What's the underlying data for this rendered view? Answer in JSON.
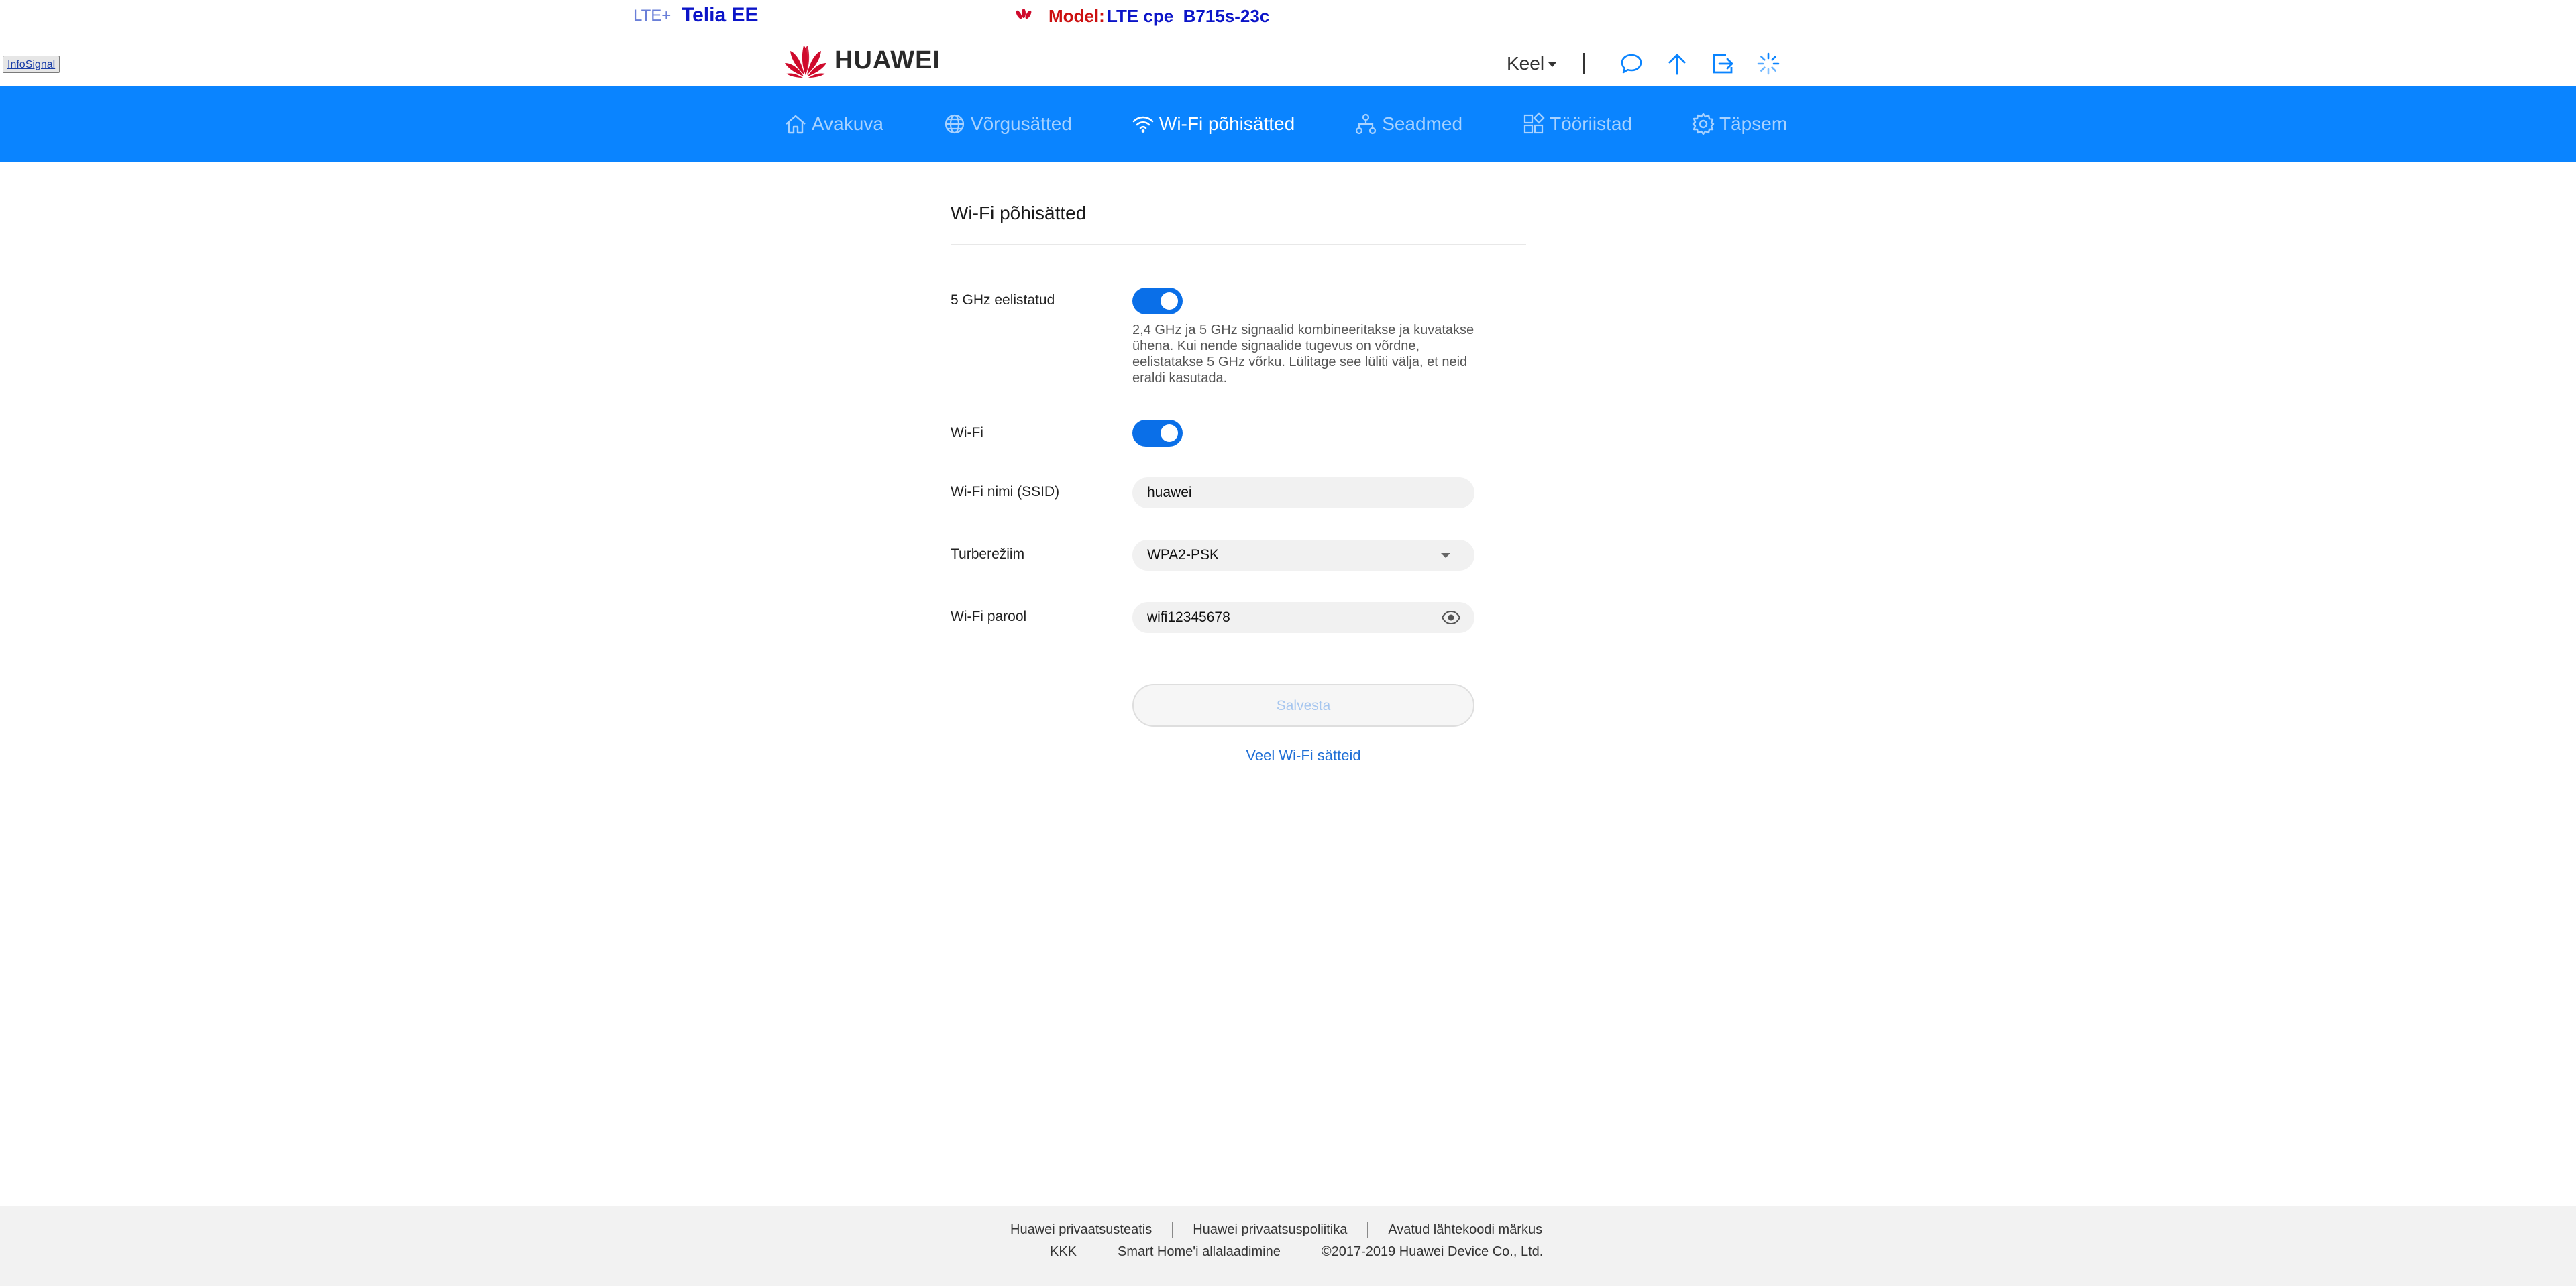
{
  "status": {
    "network_type": "LTE+",
    "operator": "Telia EE",
    "model_label": "Model:",
    "model_value": "LTE cpe  B715s-23c"
  },
  "info_button": "InfoSignal",
  "header": {
    "brand": "HUAWEI",
    "language": "Keel",
    "icons": [
      "message-icon",
      "upload-icon",
      "logout-icon",
      "loading-icon"
    ]
  },
  "nav": {
    "items": [
      {
        "label": "Avakuva",
        "icon": "home-icon",
        "active": false
      },
      {
        "label": "Võrgusätted",
        "icon": "globe-icon",
        "active": false
      },
      {
        "label": "Wi-Fi põhisätted",
        "icon": "wifi-icon",
        "active": true
      },
      {
        "label": "Seadmed",
        "icon": "network-devices-icon",
        "active": false
      },
      {
        "label": "Tööriistad",
        "icon": "tools-grid-icon",
        "active": false
      },
      {
        "label": "Täpsem",
        "icon": "gear-icon",
        "active": false
      }
    ]
  },
  "main": {
    "title": "Wi-Fi põhisätted",
    "band_pref": {
      "label": "5 GHz eelistatud",
      "enabled": true,
      "hint": "2,4 GHz ja 5 GHz signaalid kombineeritakse ja kuvatakse ühena. Kui nende signaalide tugevus on võrdne, eelistatakse 5 GHz võrku. Lülitage see lüliti välja, et neid eraldi kasutada."
    },
    "wifi": {
      "label": "Wi-Fi",
      "enabled": true
    },
    "ssid": {
      "label": "Wi-Fi nimi (SSID)",
      "value": "huawei"
    },
    "security": {
      "label": "Turberežiim",
      "value": "WPA2-PSK"
    },
    "password": {
      "label": "Wi-Fi parool",
      "value": "wifi12345678"
    },
    "save_label": "Salvesta",
    "more_link": "Veel Wi-Fi sätteid"
  },
  "footer": {
    "row1": [
      "Huawei privaatsusteatis",
      "Huawei privaatsuspoliitika",
      "Avatud lähtekoodi märkus"
    ],
    "row2": [
      "KKK",
      "Smart Home'i allalaadimine",
      "©2017-2019 Huawei Device Co., Ltd."
    ]
  },
  "colors": {
    "nav_bg": "#0a84ff",
    "toggle_on": "#0a6fe8",
    "link": "#1f6fd6",
    "brand_red": "#cf0a2c"
  }
}
